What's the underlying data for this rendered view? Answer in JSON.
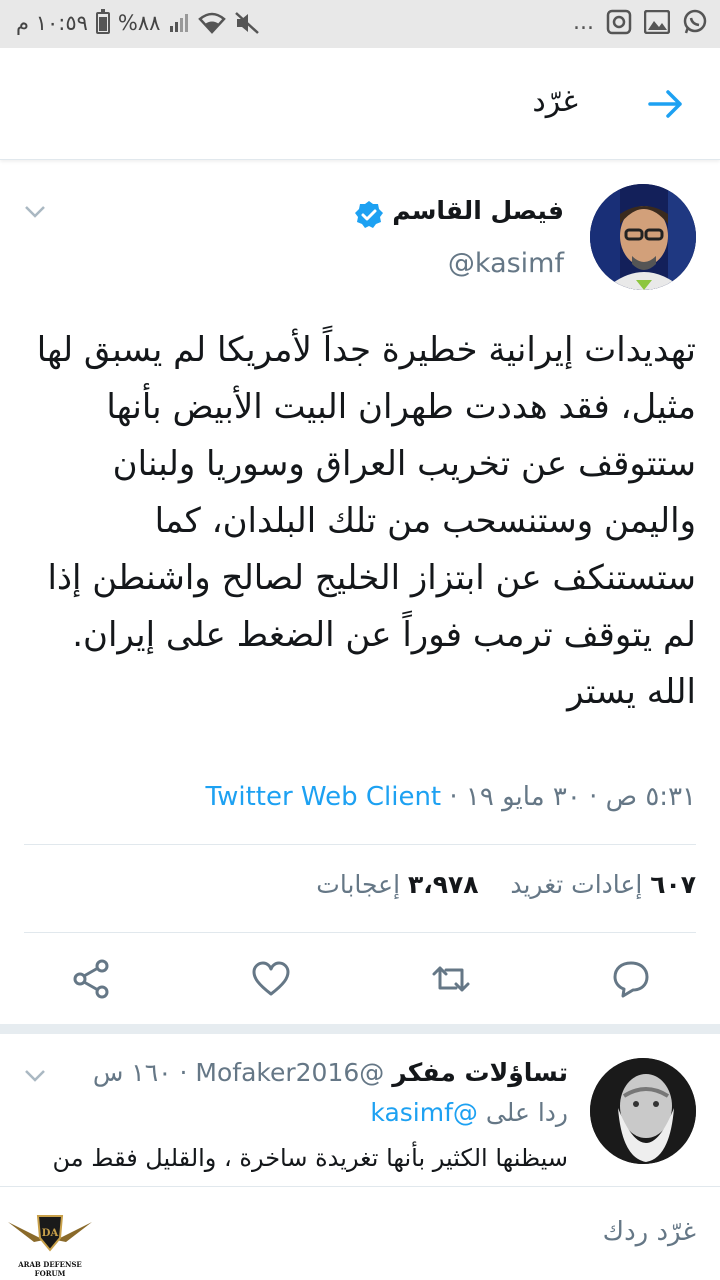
{
  "status_bar": {
    "time": "١٠:٥٩ م",
    "battery": "%٨٨",
    "more": "...",
    "icons": [
      "whatsapp-icon",
      "gallery-icon",
      "notification-icon",
      "mute-icon",
      "wifi-icon",
      "signal-icon",
      "battery-icon"
    ]
  },
  "app_bar": {
    "title": "غرّد",
    "back_icon": "arrow-right-icon"
  },
  "tweet": {
    "author_name": "فيصل القاسم",
    "author_handle": "@kasimf",
    "verified": true,
    "text": "تهديدات إيرانية خطيرة جداً لأمريكا لم يسبق لها مثيل، فقد هددت طهران البيت الأبيض بأنها ستتوقف عن تخريب العراق وسوريا ولبنان واليمن وستنسحب من تلك البلدان، كما ستستنكف عن ابتزاز الخليج لصالح واشنطن إذا لم يتوقف ترمب فوراً عن الضغط على إيران.\nالله يستر",
    "timestamp": "٥:٣١ ص · ٣٠ مايو ١٩ · ",
    "client": "Twitter Web Client",
    "retweets_count": "٦٠٧",
    "retweets_label": "إعادات تغريد",
    "likes_count": "٣،٩٧٨",
    "likes_label": "إعجابات"
  },
  "actions": [
    "reply-icon",
    "retweet-icon",
    "like-icon",
    "share-icon"
  ],
  "reply": {
    "author_name": "تساؤلات مفكر",
    "author_handle": "@Mofaker2016",
    "time": "١٦٠ س",
    "replying_label": "ردا على",
    "replying_mention": "@kasimf",
    "text": "سيظنها الكثير بأنها تغريدة ساخرة ، والقليل فقط من"
  },
  "compose": {
    "placeholder": "غرّد ردك"
  },
  "watermark": {
    "text": "ARAB DEFENSE FORUM"
  },
  "colors": {
    "accent": "#1da1f2",
    "text": "#14171a",
    "secondary": "#657786",
    "border": "#e1e8ed"
  }
}
